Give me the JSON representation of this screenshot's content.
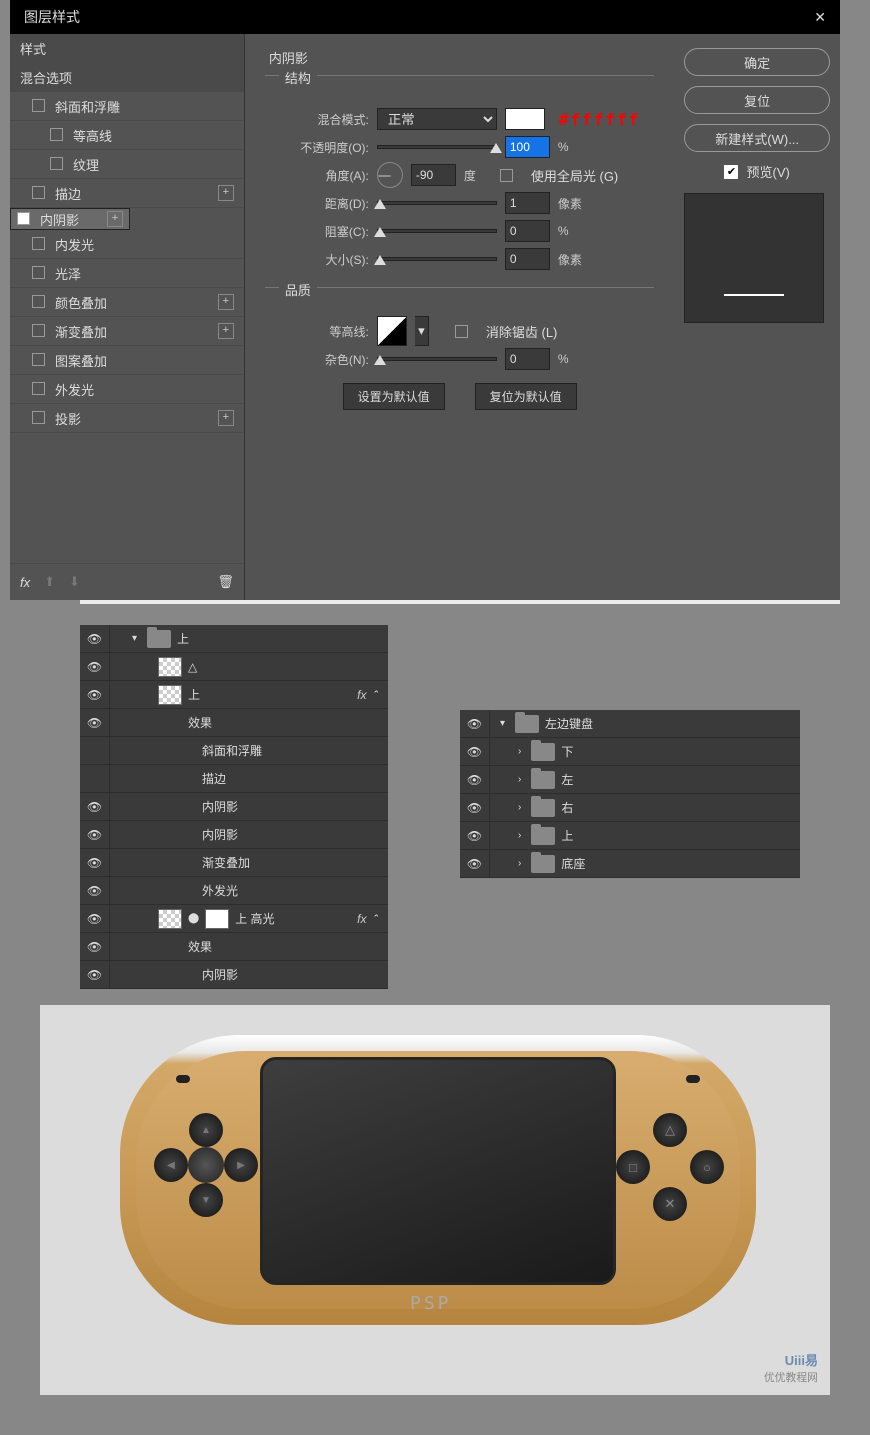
{
  "dialog": {
    "title": "图层样式",
    "styles_header": "样式",
    "blend_header": "混合选项",
    "effects": {
      "bevel": "斜面和浮雕",
      "contour": "等高线",
      "texture": "纹理",
      "stroke": "描边",
      "inner_shadow": "内阴影",
      "inner_glow": "内发光",
      "satin": "光泽",
      "color_overlay": "颜色叠加",
      "gradient_overlay": "渐变叠加",
      "pattern_overlay": "图案叠加",
      "outer_glow": "外发光",
      "drop_shadow": "投影"
    },
    "panel": {
      "title": "内阴影",
      "structure": "结构",
      "blend_mode_label": "混合模式:",
      "blend_mode_value": "正常",
      "hex_note": "#ffffff",
      "opacity_label": "不透明度(O):",
      "opacity_value": "100",
      "opacity_unit": "%",
      "angle_label": "角度(A):",
      "angle_value": "-90",
      "angle_unit": "度",
      "global_light": "使用全局光 (G)",
      "distance_label": "距离(D):",
      "distance_value": "1",
      "distance_unit": "像素",
      "choke_label": "阻塞(C):",
      "choke_value": "0",
      "choke_unit": "%",
      "size_label": "大小(S):",
      "size_value": "0",
      "size_unit": "像素",
      "quality": "品质",
      "contour_label": "等高线:",
      "antialias": "消除锯齿 (L)",
      "noise_label": "杂色(N):",
      "noise_value": "0",
      "noise_unit": "%",
      "set_default": "设置为默认值",
      "reset_default": "复位为默认值"
    },
    "buttons": {
      "ok": "确定",
      "cancel": "复位",
      "new_style": "新建样式(W)...",
      "preview": "预览(V)"
    },
    "fx_label": "fx"
  },
  "layers1": {
    "root": "上",
    "triangle": "△",
    "sub": "上",
    "effects": "效果",
    "bevel": "斜面和浮雕",
    "stroke": "描边",
    "inner_shadow1": "内阴影",
    "inner_shadow2": "内阴影",
    "gradient": "渐变叠加",
    "outer_glow": "外发光",
    "highlight": "上 高光",
    "hl_effects": "效果",
    "hl_inner": "内阴影",
    "fx": "fx"
  },
  "layers2": {
    "root": "左边键盘",
    "down": "下",
    "left": "左",
    "right": "右",
    "up": "上",
    "base": "底座"
  },
  "psp": {
    "logo": "PSP"
  },
  "watermark": {
    "brand": "Uiii易",
    "sub": "优优教程网"
  }
}
